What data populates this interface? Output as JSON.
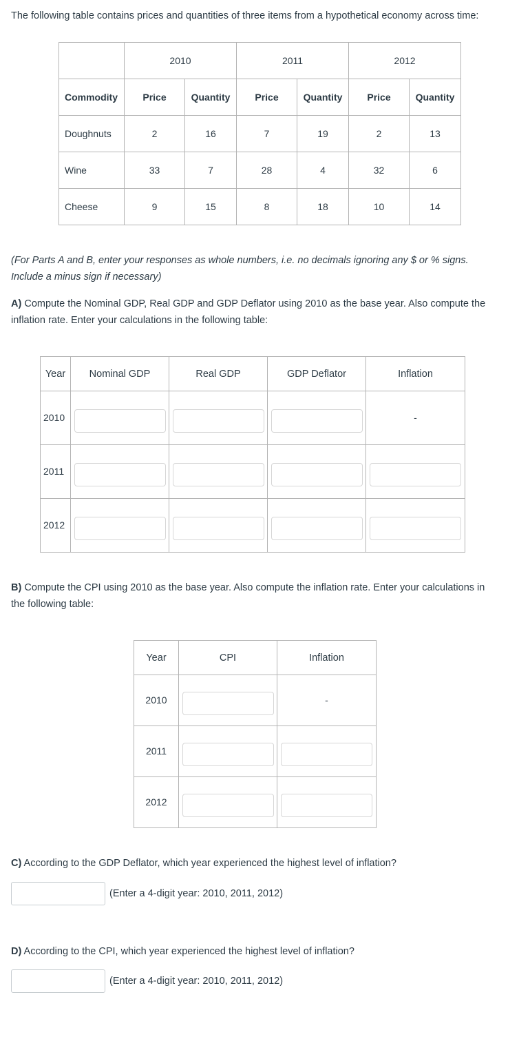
{
  "intro": {
    "text": "The following table contains prices and quantities of three items from a hypothetical economy across time:"
  },
  "price_quantity_table": {
    "corner_label": "",
    "year_groups": [
      "2010",
      "2011",
      "2012"
    ],
    "sub_headers": [
      "Price",
      "Quantity",
      "Price",
      "Quantity",
      "Price",
      "Quantity"
    ],
    "row_header": "Commodity",
    "rows": [
      {
        "commodity": "Doughnuts",
        "values": [
          "2",
          "16",
          "7",
          "19",
          "2",
          "13"
        ]
      },
      {
        "commodity": "Wine",
        "values": [
          "33",
          "7",
          "28",
          "4",
          "32",
          "6"
        ]
      },
      {
        "commodity": "Cheese",
        "values": [
          "9",
          "15",
          "8",
          "18",
          "10",
          "14"
        ]
      }
    ]
  },
  "note": {
    "text": "(For Parts A and B, enter your responses as whole numbers, i.e. no decimals ignoring any $ or % signs. Include a minus sign if necessary)"
  },
  "part_a": {
    "label": "A)",
    "text": " Compute the Nominal GDP, Real GDP and GDP Deflator using 2010 as the base year. Also compute the inflation rate. Enter your calculations in the following table:",
    "table": {
      "headers": [
        "Year",
        "Nominal GDP",
        "Real GDP",
        "GDP Deflator",
        "Inflation"
      ],
      "rows": [
        {
          "year": "2010",
          "nominal_gdp": "",
          "real_gdp": "",
          "gdp_deflator": "",
          "inflation": "-",
          "inflation_is_input": false
        },
        {
          "year": "2011",
          "nominal_gdp": "",
          "real_gdp": "",
          "gdp_deflator": "",
          "inflation": "",
          "inflation_is_input": true
        },
        {
          "year": "2012",
          "nominal_gdp": "",
          "real_gdp": "",
          "gdp_deflator": "",
          "inflation": "",
          "inflation_is_input": true
        }
      ]
    }
  },
  "part_b": {
    "label": "B)",
    "text": " Compute the CPI using 2010 as the base year. Also compute the inflation rate. Enter your calculations in the following table:",
    "table": {
      "headers": [
        "Year",
        "CPI",
        "Inflation"
      ],
      "rows": [
        {
          "year": "2010",
          "cpi": "",
          "inflation": "-",
          "inflation_is_input": false
        },
        {
          "year": "2011",
          "cpi": "",
          "inflation": "",
          "inflation_is_input": true
        },
        {
          "year": "2012",
          "cpi": "",
          "inflation": "",
          "inflation_is_input": true
        }
      ]
    }
  },
  "part_c": {
    "label": "C)",
    "text": " According to the GDP Deflator, which year experienced the highest level of inflation?",
    "answer_value": "",
    "hint": "(Enter a 4-digit year: 2010, 2011, 2012)"
  },
  "part_d": {
    "label": "D)",
    "text": " According to the CPI, which year experienced the highest level of inflation?",
    "answer_value": "",
    "hint": "(Enter a 4-digit year: 2010, 2011, 2012)"
  },
  "colors": {
    "text": "#2d3b45",
    "table_border": "#b3b3b3",
    "answer_table_border": "#6b6b6b",
    "input_border": "#d6d6d6",
    "background": "#ffffff"
  }
}
